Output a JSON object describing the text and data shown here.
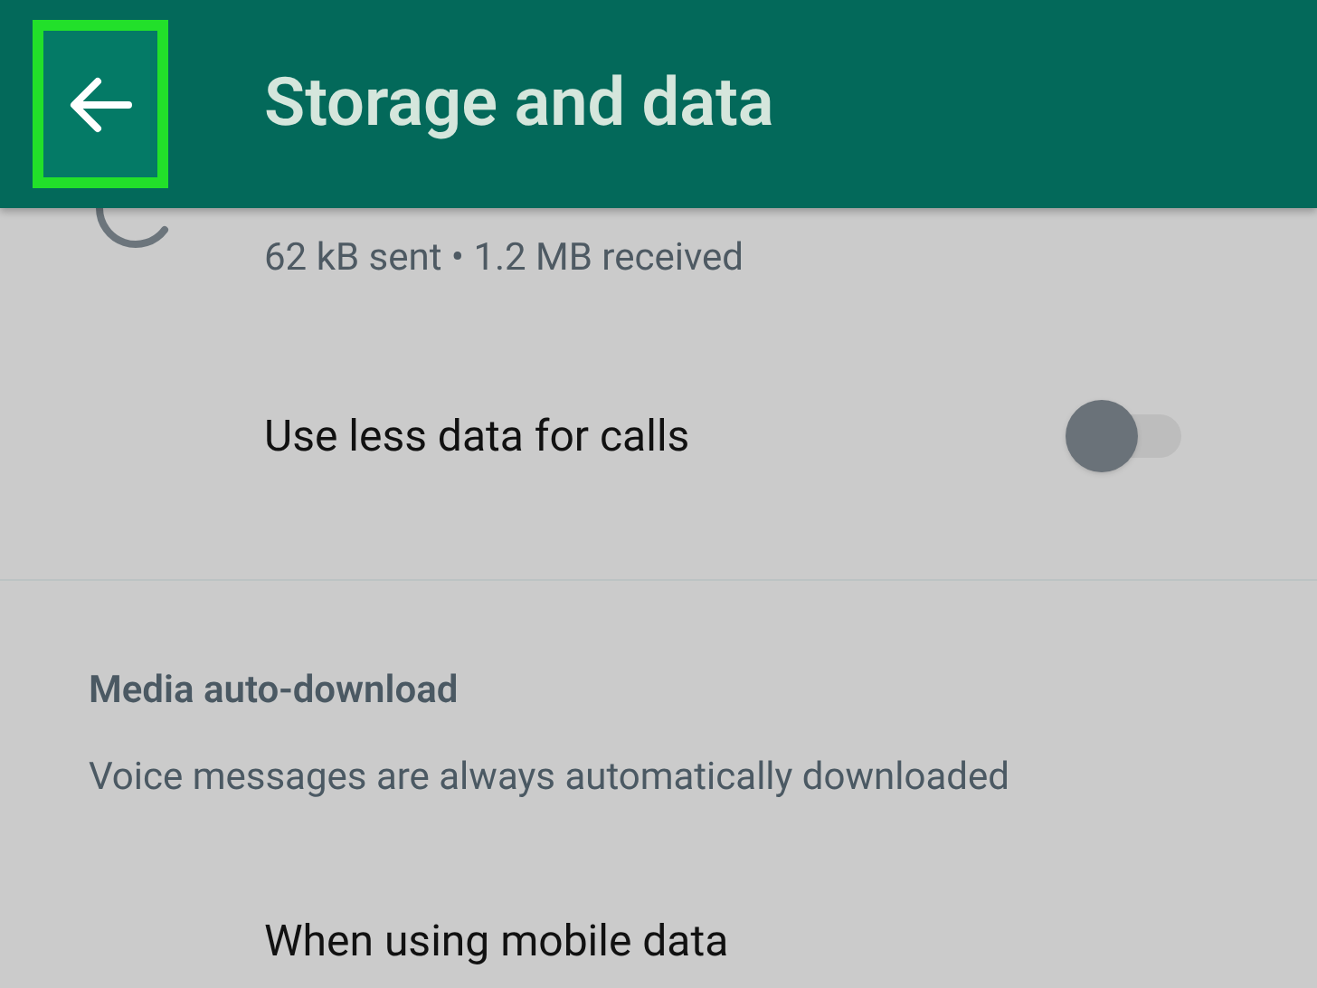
{
  "header": {
    "title": "Storage and data",
    "back_highlighted": true
  },
  "network_usage": {
    "summary": "62 kB sent • 1.2 MB received"
  },
  "settings": [
    {
      "kind": "toggle",
      "label": "Use less data for calls",
      "on": false
    }
  ],
  "media_auto_download": {
    "title": "Media auto-download",
    "note": "Voice messages are always automatically downloaded",
    "items": [
      {
        "label": "When using mobile data"
      }
    ]
  }
}
